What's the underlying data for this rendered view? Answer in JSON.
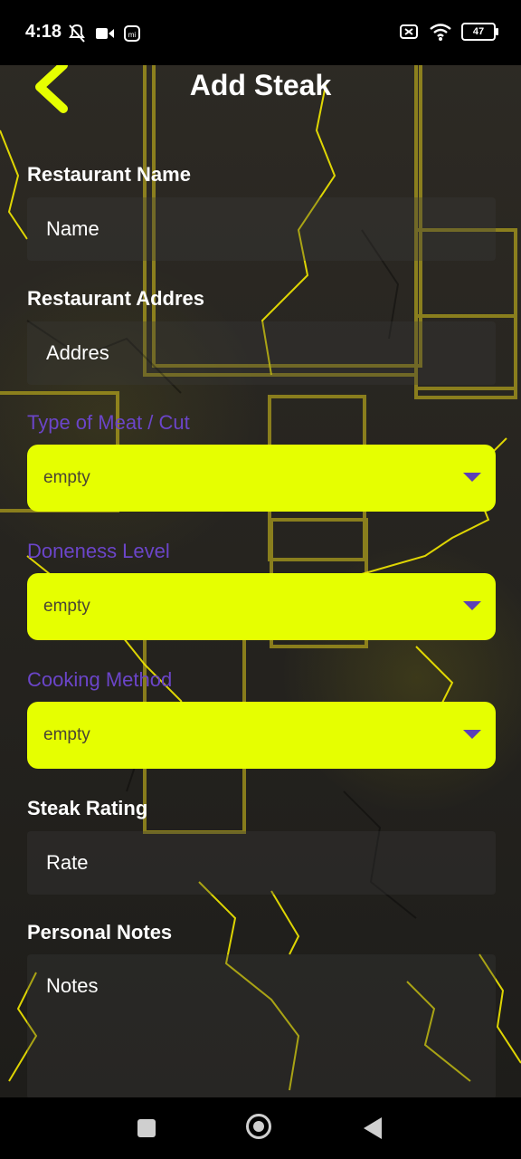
{
  "status_bar": {
    "time": "4:18",
    "battery": "47"
  },
  "header": {
    "title": "Add Steak",
    "back_icon": "chevron-left-icon"
  },
  "form": {
    "restaurant_name": {
      "label": "Restaurant Name",
      "placeholder": "Name"
    },
    "restaurant_address": {
      "label": "Restaurant Addres",
      "placeholder": "Addres"
    },
    "meat_type": {
      "label": "Type of Meat / Cut",
      "value": "empty"
    },
    "doneness": {
      "label": "Doneness Level",
      "value": "empty"
    },
    "cooking_method": {
      "label": "Cooking Method",
      "value": "empty"
    },
    "rating": {
      "label": "Steak Rating",
      "placeholder": "Rate"
    },
    "notes": {
      "label": "Personal Notes",
      "placeholder": "Notes"
    }
  },
  "colors": {
    "accent": "#e6ff00",
    "purple": "#6b45c9",
    "text": "#ffffff",
    "dropdown_text": "#4a4533"
  }
}
